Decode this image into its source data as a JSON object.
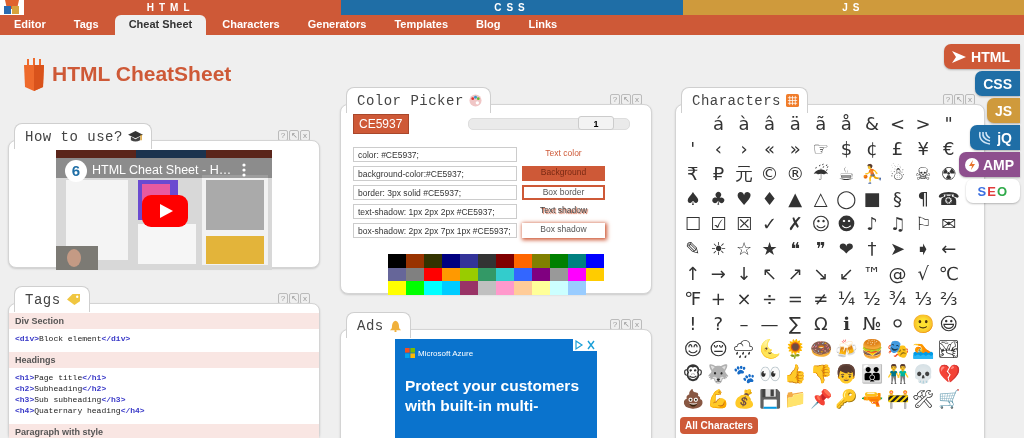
{
  "top_sections": [
    {
      "label": "HTML",
      "color": "#ce5937"
    },
    {
      "label": "CSS",
      "color": "#1f6ea6"
    },
    {
      "label": "JS",
      "color": "#cf9a3c"
    }
  ],
  "nav": [
    {
      "label": "Editor",
      "selected": false
    },
    {
      "label": "Tags",
      "selected": false
    },
    {
      "label": "Cheat Sheet",
      "selected": true
    },
    {
      "label": "Characters",
      "selected": false
    },
    {
      "label": "Generators",
      "selected": false
    },
    {
      "label": "Templates",
      "selected": false
    },
    {
      "label": "Blog",
      "selected": false
    },
    {
      "label": "Links",
      "selected": false
    }
  ],
  "page_title": "HTML CheatSheet",
  "side_tabs": [
    {
      "label": "HTML",
      "kind": "arrow",
      "color": "#ce5937"
    },
    {
      "label": "CSS",
      "kind": "plain",
      "color": "#1f6ea6"
    },
    {
      "label": "JS",
      "kind": "plain",
      "color": "#cf9a3c"
    },
    {
      "label": "jQ",
      "kind": "swirl",
      "color": "#1f6ea6"
    },
    {
      "label": "AMP",
      "kind": "bolt",
      "color": "#8e4f8e"
    },
    {
      "label": "SEO",
      "kind": "multicolor",
      "color": "#ffffff"
    }
  ],
  "how_to_use": {
    "title": "How to use?",
    "controls": [
      "?",
      "↖",
      "x"
    ],
    "video": {
      "badge": "6",
      "title": "HTML Cheat Sheet - H…"
    }
  },
  "tags": {
    "title": "Tags",
    "controls": [
      "?",
      "↖",
      "x"
    ],
    "sections": [
      {
        "heading": "Div Section",
        "lines": [
          {
            "open": "<div>",
            "text": "Block element",
            "close": "</div>"
          }
        ]
      },
      {
        "heading": "Headings",
        "lines": [
          {
            "open": "<h1>",
            "text": "Page title",
            "close": "</h1>"
          },
          {
            "open": "<h2>",
            "text": "Subheading",
            "close": "</h2>"
          },
          {
            "open": "<h3>",
            "text": "Sub subheading",
            "close": "</h3>"
          },
          {
            "open": "<h4>",
            "text": "Quaternary heading",
            "close": "</h4>"
          }
        ]
      },
      {
        "heading": "Paragraph with style"
      }
    ]
  },
  "color_picker": {
    "title": "Color Picker",
    "controls": [
      "?",
      "↖",
      "x"
    ],
    "hex": "CE5937",
    "slider": {
      "level": 0.88,
      "value": "1"
    },
    "rows": [
      {
        "code": "color: #CE5937;",
        "sample": "Text color",
        "kind": "text-color"
      },
      {
        "code": "background-color:#CE5937;",
        "sample": "Background",
        "kind": "background"
      },
      {
        "code": "border: 3px solid #CE5937;",
        "sample": "Box border",
        "kind": "border"
      },
      {
        "code": "text-shadow: 1px 2px 2px #CE5937;",
        "sample": "Text shadow",
        "kind": "text-shadow"
      },
      {
        "code": "box-shadow: 2px 2px 7px 1px #CE5937;",
        "sample": "Box shadow",
        "kind": "box-shadow"
      }
    ],
    "palette": [
      {
        "color": "#000000"
      },
      {
        "color": "#993300"
      },
      {
        "color": "#333300"
      },
      {
        "color": "#000080"
      },
      {
        "color": "#333399"
      },
      {
        "color": "#333333"
      },
      {
        "color": "#800000"
      },
      {
        "color": "#ff6600"
      },
      {
        "color": "#808000"
      },
      {
        "color": "#008000"
      },
      {
        "color": "#008080"
      },
      {
        "color": "#0000ff"
      },
      {
        "color": "#666699"
      },
      {
        "color": "#808080"
      },
      {
        "color": "#ff0000"
      },
      {
        "color": "#ff9900"
      },
      {
        "color": "#99cc00"
      },
      {
        "color": "#339966"
      },
      {
        "color": "#33cccc"
      },
      {
        "color": "#3366ff"
      },
      {
        "color": "#800080"
      },
      {
        "color": "#999999"
      },
      {
        "color": "#ff00ff"
      },
      {
        "color": "#ffcc00"
      },
      {
        "color": "#ffff00"
      },
      {
        "color": "#00ff00"
      },
      {
        "color": "#00ffff"
      },
      {
        "color": "#00ccff"
      },
      {
        "color": "#993366"
      },
      {
        "color": "#c0c0c0"
      },
      {
        "color": "#ff99cc"
      },
      {
        "color": "#ffcc99"
      },
      {
        "color": "#ffff99"
      },
      {
        "color": "#ccffff"
      },
      {
        "color": "#99ccff"
      }
    ]
  },
  "ads": {
    "title": "Ads",
    "controls": [
      "?",
      "↖",
      "x"
    ],
    "ad": {
      "brand": "Microsoft Azure",
      "headline": "Protect your customers with built-in multi-"
    }
  },
  "characters": {
    "title": "Characters",
    "controls": [
      "?",
      "↖",
      "x"
    ],
    "chars": [
      "á",
      "à",
      "â",
      "ä",
      "ã",
      "å",
      "&",
      "<",
      ">",
      "\"",
      "'",
      "‹",
      "›",
      "«",
      "»",
      "☞",
      "$",
      "¢",
      "£",
      "¥",
      "€",
      "₹",
      "₽",
      "元",
      "©",
      "®",
      "☔",
      "☕",
      "⛹",
      "☃",
      "☠",
      "☢",
      "♠",
      "♣",
      "♥",
      "♦",
      "▲",
      "△",
      "◯",
      "■",
      "§",
      "¶",
      "☎",
      "☐",
      "☑",
      "☒",
      "✓",
      "✗",
      "☺",
      "☻",
      "♪",
      "♫",
      "⚐",
      "✉",
      "✎",
      "☀",
      "☆",
      "★",
      "❝",
      "❞",
      "❤",
      "†",
      "➤",
      "➧",
      "←",
      "↑",
      "→",
      "↓",
      "↖",
      "↗",
      "↘",
      "↙",
      "™",
      "@",
      "√",
      "℃",
      "℉",
      "+",
      "×",
      "÷",
      "=",
      "≠",
      "¼",
      "½",
      "¾",
      "⅓",
      "⅔",
      "!",
      "?",
      "–",
      "—",
      "∑",
      "Ω",
      "ℹ",
      "№",
      "⚪",
      "🙂",
      "😃",
      "😊",
      "😔",
      "🌧",
      "🌜",
      "🌻",
      "🍩",
      "🍻",
      "🍔",
      "🎭",
      "🏊",
      "🏞",
      "🐵",
      "🐺",
      "🐾",
      "👀",
      "👍",
      "👎",
      "👦",
      "👪",
      "👬",
      "💀",
      "💔",
      "💩",
      "💪",
      "💰",
      "💾",
      "📁",
      "📌",
      "🔑",
      "🔫",
      "🚧",
      "🛠",
      "🛒"
    ],
    "button": "All Characters"
  }
}
